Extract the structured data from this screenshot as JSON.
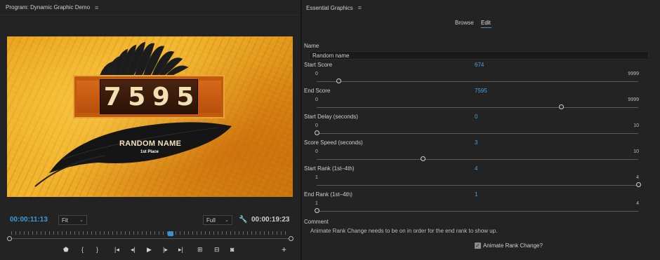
{
  "program": {
    "title": "Program: Dynamic Graphic Demo",
    "menu_icon": "hamburger-menu-icon",
    "preview": {
      "score_digits": [
        "7",
        "5",
        "9",
        "5"
      ],
      "name_text": "RANDOM NAME",
      "place_text": "1st Place"
    },
    "timecode_current": "00:00:11:13",
    "fit_select": "Fit",
    "quality_select": "Full",
    "timecode_duration": "00:00:19:23",
    "playhead_position": 0.57,
    "accent_color": "#3d9ad8"
  },
  "essential_graphics": {
    "title": "Essential Graphics",
    "tabs": {
      "browse": "Browse",
      "edit": "Edit"
    },
    "active_tab": "Edit",
    "name_label": "Name",
    "name_value": "Random name",
    "params": [
      {
        "label": "Start Score",
        "value": "674",
        "min": "0",
        "max": "9999",
        "fraction": 0.067
      },
      {
        "label": "End Score",
        "value": "7595",
        "min": "0",
        "max": "9999",
        "fraction": 0.76
      },
      {
        "label": "Start Delay (seconds)",
        "value": "0",
        "min": "0",
        "max": "10",
        "fraction": 0.0
      },
      {
        "label": "Score Speed (seconds)",
        "value": "3",
        "min": "0",
        "max": "10",
        "fraction": 0.33
      },
      {
        "label": "Start Rank (1st–4th)",
        "value": "4",
        "min": "1",
        "max": "4",
        "fraction": 1.0
      },
      {
        "label": "End Rank (1st–4th)",
        "value": "1",
        "min": "1",
        "max": "4",
        "fraction": 0.0
      }
    ],
    "comment_label": "Comment",
    "comment_text": "Animate Rank Change needs to be on in order for the end rank to show up.",
    "checkbox_label": "Animate Rank Change?",
    "checkbox_checked": true,
    "value_color": "#4aa0e0"
  }
}
